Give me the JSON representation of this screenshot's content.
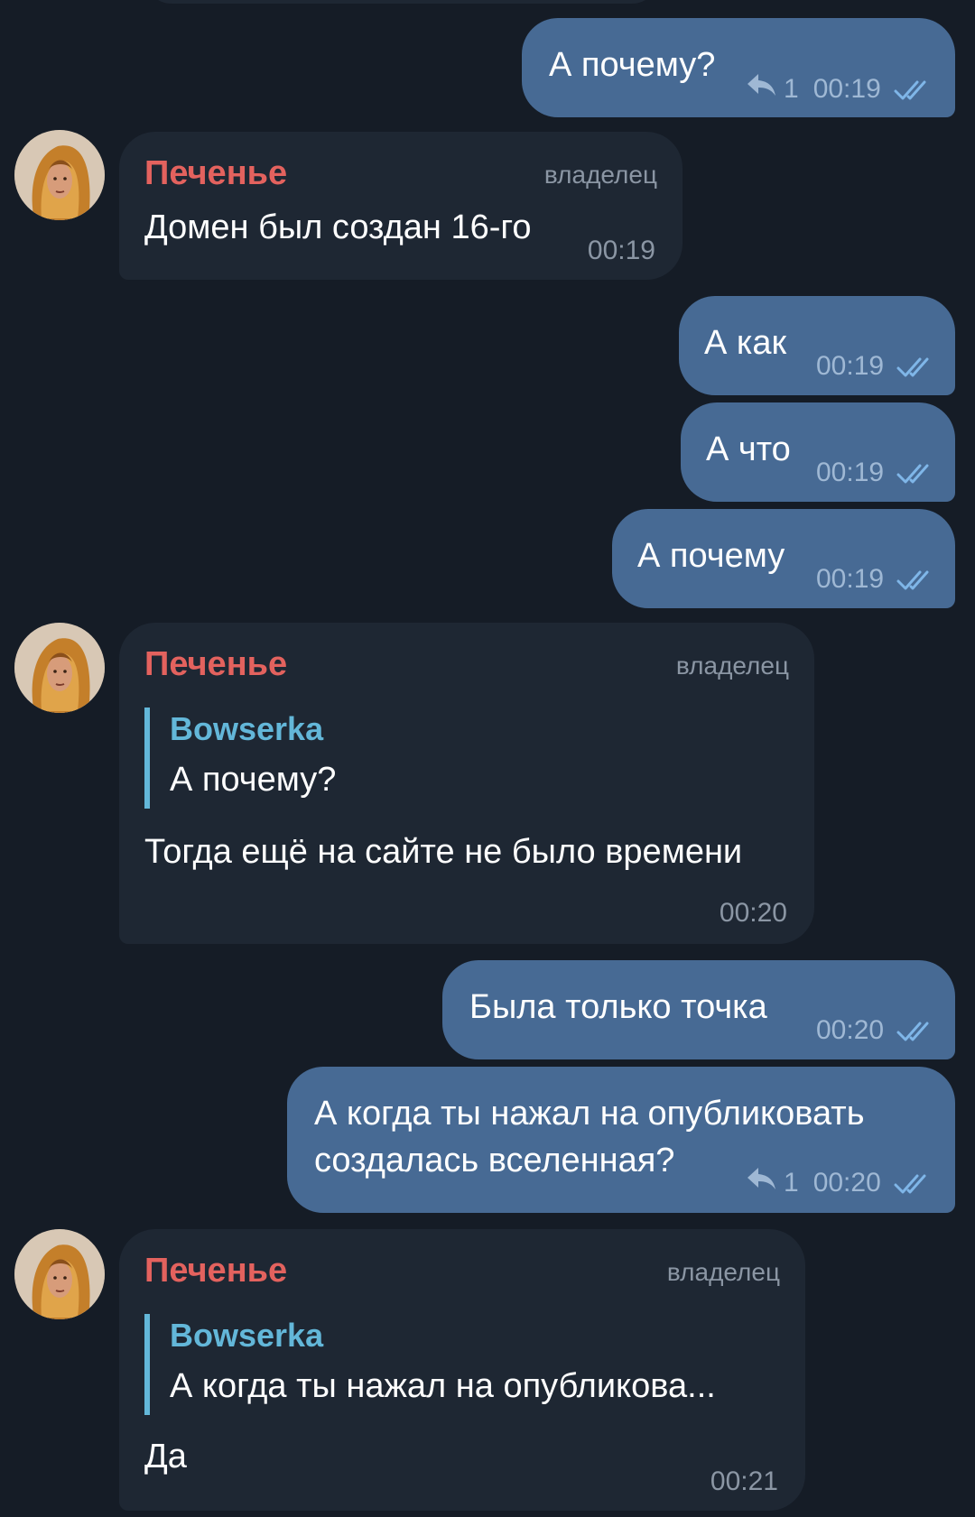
{
  "messages": [
    {
      "text": "А почему?",
      "time": "00:19",
      "replies": "1"
    },
    {
      "sender": "Печенье",
      "role": "владелец",
      "text": "Домен был создан 16-го",
      "time": "00:19"
    },
    {
      "text": "А как",
      "time": "00:19"
    },
    {
      "text": "А что",
      "time": "00:19"
    },
    {
      "text": "А почему",
      "time": "00:19"
    },
    {
      "sender": "Печенье",
      "role": "владелец",
      "reply_to": {
        "author": "Bowserka",
        "text": "А почему?"
      },
      "text": "Тогда ещё на сайте не было времени",
      "time": "00:20"
    },
    {
      "text": "Была только точка",
      "time": "00:20"
    },
    {
      "text_line1": "А когда ты нажал на опубликовать",
      "text_line2": "создалась вселенная?",
      "time": "00:20",
      "replies": "1"
    },
    {
      "sender": "Печенье",
      "role": "владелец",
      "reply_to": {
        "author": "Bowserka",
        "text": "А когда ты нажал на опубликова..."
      },
      "text": "Да",
      "time": "00:21"
    }
  ],
  "colors": {
    "background": "#151c26",
    "outgoing_bubble": "#476a94",
    "incoming_bubble": "#1e2733",
    "sender_name": "#e3625e",
    "reply_accent": "#63b7d9",
    "read_check": "#7fb6e8"
  },
  "icons": {
    "avatar": "avatar-blonde-portrait",
    "read": "double-check-icon",
    "reply": "reply-arrow-icon"
  }
}
